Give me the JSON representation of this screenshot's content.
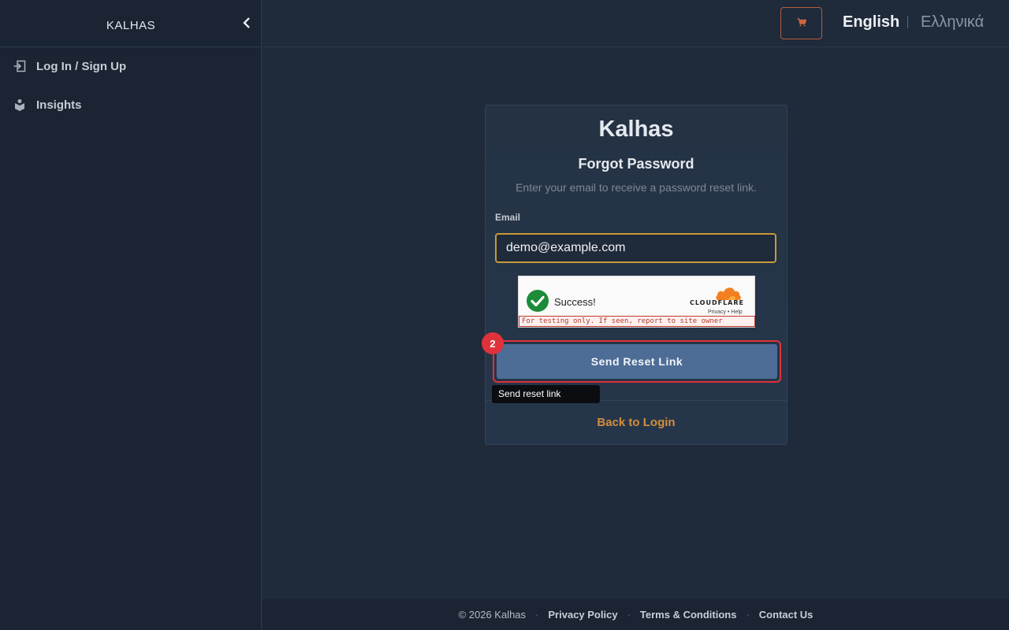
{
  "sidebar": {
    "brand": "KALHAS",
    "collapse_icon": "chevron-left-icon",
    "items": [
      {
        "label": "Log In / Sign Up",
        "icon": "login-icon"
      },
      {
        "label": "Insights",
        "icon": "insights-icon"
      }
    ]
  },
  "topbar": {
    "cart_icon": "cart-icon",
    "languages": [
      {
        "label": "English",
        "active": true
      },
      {
        "label": "Ελληνικά",
        "active": false
      }
    ]
  },
  "form": {
    "title": "Kalhas",
    "subtitle": "Forgot Password",
    "description": "Enter your email to receive a password reset link.",
    "email_label": "Email",
    "email_value": "demo@example.com",
    "captcha": {
      "status": "Success!",
      "brand": "CLOUDFLARE",
      "links": "Privacy • Help",
      "warning": "For testing only. If seen, report to site owner"
    },
    "submit_label": "Send Reset Link",
    "marker_number": "2",
    "tooltip": "Send reset link",
    "back_link": "Back to Login"
  },
  "footer": {
    "copyright": "© 2026 Kalhas",
    "links": [
      "Privacy Policy",
      "Terms & Conditions",
      "Contact Us"
    ]
  },
  "colors": {
    "background": "#1f2a3a",
    "accent": "#d18f3d",
    "button": "#4d6d97",
    "highlight": "#e0323b"
  }
}
